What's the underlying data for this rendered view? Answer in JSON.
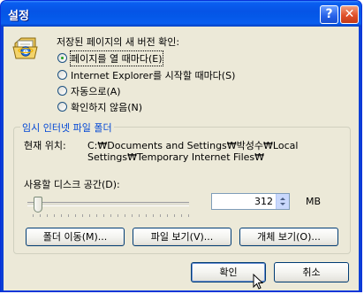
{
  "window": {
    "title": "설정"
  },
  "titlebar": {
    "help_glyph": "?",
    "close_glyph": "✕"
  },
  "check": {
    "prompt": "저장된 페이지의 새 버전 확인:",
    "options": [
      {
        "label": "페이지를 열 때마다(E)",
        "selected": true
      },
      {
        "label": "Internet Explorer를 시작할 때마다(S)",
        "selected": false
      },
      {
        "label": "자동으로(A)",
        "selected": false
      },
      {
        "label": "확인하지 않음(N)",
        "selected": false
      }
    ]
  },
  "temp": {
    "group_title": "임시 인터넷 파일 폴더",
    "location_label": "현재 위치:",
    "location_line1": "C:₩Documents and Settings₩박성수₩Local",
    "location_line2": "Settings₩Temporary Internet Files₩",
    "disk_label": "사용할 디스크 공간(D):",
    "disk_value": "312",
    "disk_unit": "MB",
    "slider_fraction": 0.04,
    "buttons": {
      "move": "폴더 이동(M)...",
      "view_files": "파일 보기(V)...",
      "view_objects": "개체 보기(O)..."
    }
  },
  "footer": {
    "ok": "확인",
    "cancel": "취소"
  },
  "colors": {
    "title_bar": "#0654e6",
    "group_title": "#0046d5",
    "face": "#ece9d8"
  },
  "icons": {
    "settings": "ie-page-icon",
    "cursor": "mouse-pointer-icon"
  }
}
